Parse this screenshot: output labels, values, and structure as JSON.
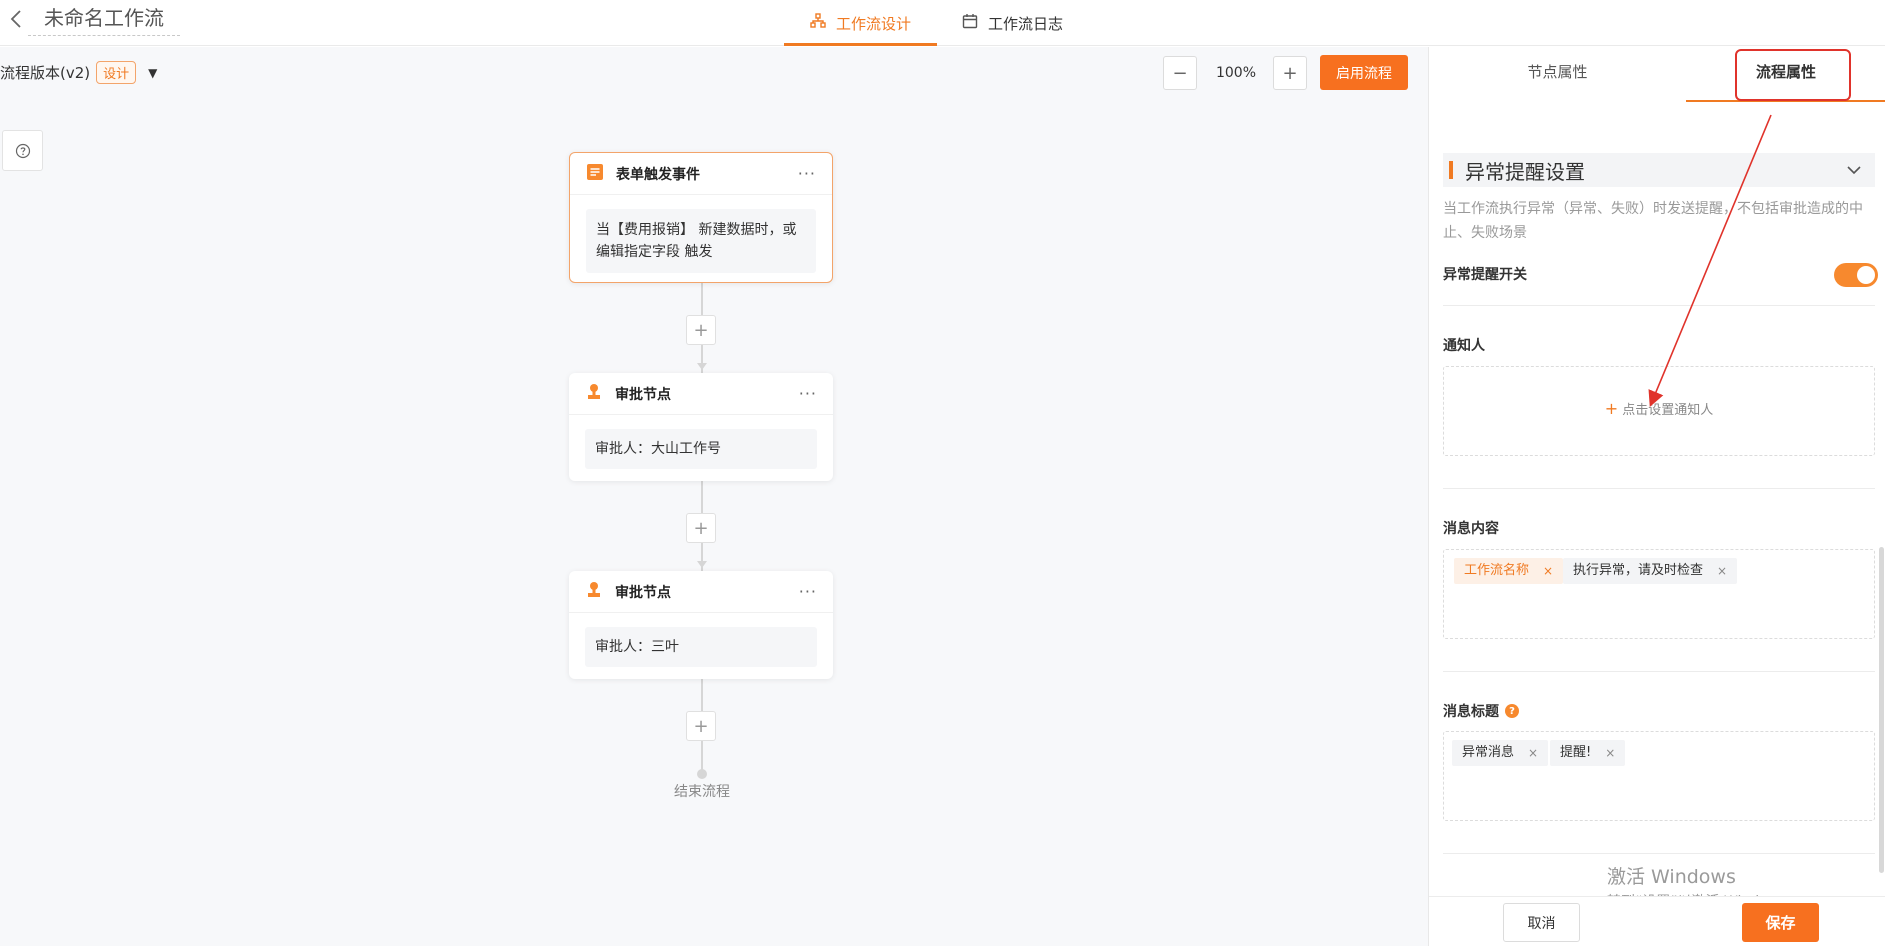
{
  "header": {
    "title": "未命名工作流",
    "tabs": [
      {
        "label": "工作流设计",
        "active": true
      },
      {
        "label": "工作流日志",
        "active": false
      }
    ]
  },
  "canvas": {
    "version_label": "流程版本(v2)",
    "version_badge": "设计",
    "zoom": "100%",
    "zoom_out": "−",
    "zoom_in": "+",
    "enable_button": "启用流程",
    "nodes": [
      {
        "title": "表单触发事件",
        "body": "当【费用报销】 新建数据时，或编辑指定字段 触发",
        "icon": "form-icon"
      },
      {
        "title": "审批节点",
        "body": "审批人：大山工作号",
        "icon": "approver-icon"
      },
      {
        "title": "审批节点",
        "body": "审批人：三叶",
        "icon": "approver-icon"
      }
    ],
    "add_node": "+",
    "node_more": "···",
    "end_label": "结束流程"
  },
  "panel": {
    "tabs": [
      {
        "label": "节点属性",
        "active": false
      },
      {
        "label": "流程属性",
        "active": true
      }
    ],
    "section_title": "异常提醒设置",
    "description": "当工作流执行异常（异常、失败）时发送提醒，不包括审批造成的中止、失败场景",
    "switch_label": "异常提醒开关",
    "switch_on": true,
    "notifier_label": "通知人",
    "notifier_add": "点击设置通知人",
    "content_label": "消息内容",
    "content_tags": [
      {
        "text": "工作流名称",
        "variable": true
      },
      {
        "text": "执行异常，请及时检查",
        "variable": false
      }
    ],
    "title_label": "消息标题",
    "title_tags": [
      {
        "text": "异常消息",
        "variable": false
      },
      {
        "text": "提醒!",
        "variable": false
      }
    ],
    "tag_close": "×",
    "help_glyph": "?",
    "cancel_button": "取消",
    "save_button": "保存",
    "watermark_line1": "激活 Windows",
    "watermark_line2": "转到“设置”以激活 Windows。"
  },
  "colors": {
    "accent": "#f07a22",
    "annotation": "#e0332b"
  }
}
